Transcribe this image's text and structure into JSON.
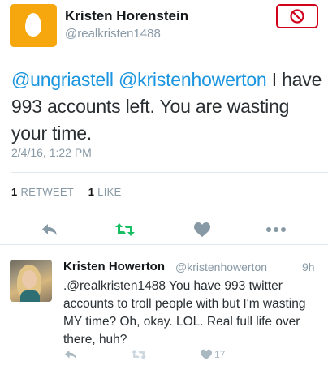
{
  "main_tweet": {
    "author_name": "Kristen Horenstein",
    "author_handle": "@realkristen1488",
    "text_mention_1": "@ungriastell",
    "text_mention_2": "@kristenhowerton",
    "text_body": " I have 993 accounts left. You are wasting your time.",
    "timestamp": "2/4/16, 1:22 PM",
    "retweet_count": "1",
    "retweet_label": "RETWEET",
    "like_count": "1",
    "like_label": "LIKE"
  },
  "reply_tweet": {
    "author_name": "Kristen Howerton",
    "author_handle": "@kristenhowerton",
    "time": "9h",
    "text": ".@realkristen1488 You have 993 twitter accounts to troll people with but I'm wasting MY time? Oh, okay. LOL. Real full life over there, huh?",
    "like_count": "17"
  },
  "colors": {
    "mention": "#1b95e0",
    "retweet_green": "#17bf63",
    "block_red": "#d0021b",
    "egg_orange": "#f5a70d",
    "muted_gray": "#8899a6"
  },
  "icons": [
    "egg-avatar-icon",
    "block-icon",
    "reply-icon",
    "retweet-icon",
    "heart-icon",
    "more-dots-icon"
  ]
}
